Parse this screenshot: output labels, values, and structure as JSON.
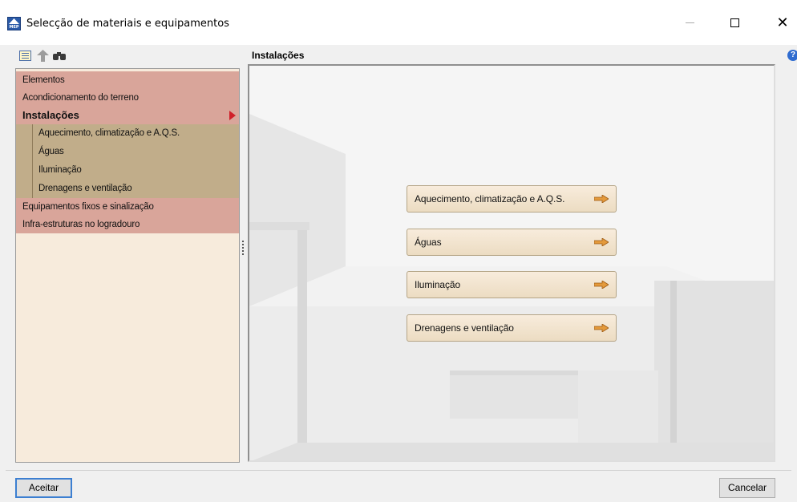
{
  "window": {
    "title": "Selecção de materiais e equipamentos",
    "icon": "mep-app-icon",
    "icon_text": "MEP"
  },
  "toolbar": {
    "icons": [
      "list-view-icon",
      "up-arrow-icon",
      "binoculars-icon"
    ]
  },
  "section_title": "Instalações",
  "tree": {
    "items": [
      {
        "label": "Elementos"
      },
      {
        "label": "Acondicionamento do terreno"
      },
      {
        "label": "Instalações",
        "active": true
      },
      {
        "label": "Equipamentos fixos e sinalização"
      },
      {
        "label": "Infra-estruturas no logradouro"
      }
    ],
    "subitems": [
      {
        "label": "Aquecimento, climatização e A.Q.S."
      },
      {
        "label": "Águas"
      },
      {
        "label": "Iluminação"
      },
      {
        "label": "Drenagens e ventilação"
      }
    ]
  },
  "buttons": [
    {
      "label": "Aquecimento, climatização e A.Q.S."
    },
    {
      "label": "Águas"
    },
    {
      "label": "Iluminação"
    },
    {
      "label": "Drenagens e ventilação"
    }
  ],
  "footer": {
    "ok_label": "Aceitar",
    "cancel_label": "Cancelar"
  },
  "colors": {
    "tree_item_bg": "#d9a59a",
    "tree_subitem_bg": "#c1ad8a",
    "tree_bg": "#f7ebdc",
    "button_bg": "#f3e4cf",
    "arrow_orange": "#d8862a",
    "active_marker": "#d0202a",
    "focus_border": "#3c7fd1"
  }
}
